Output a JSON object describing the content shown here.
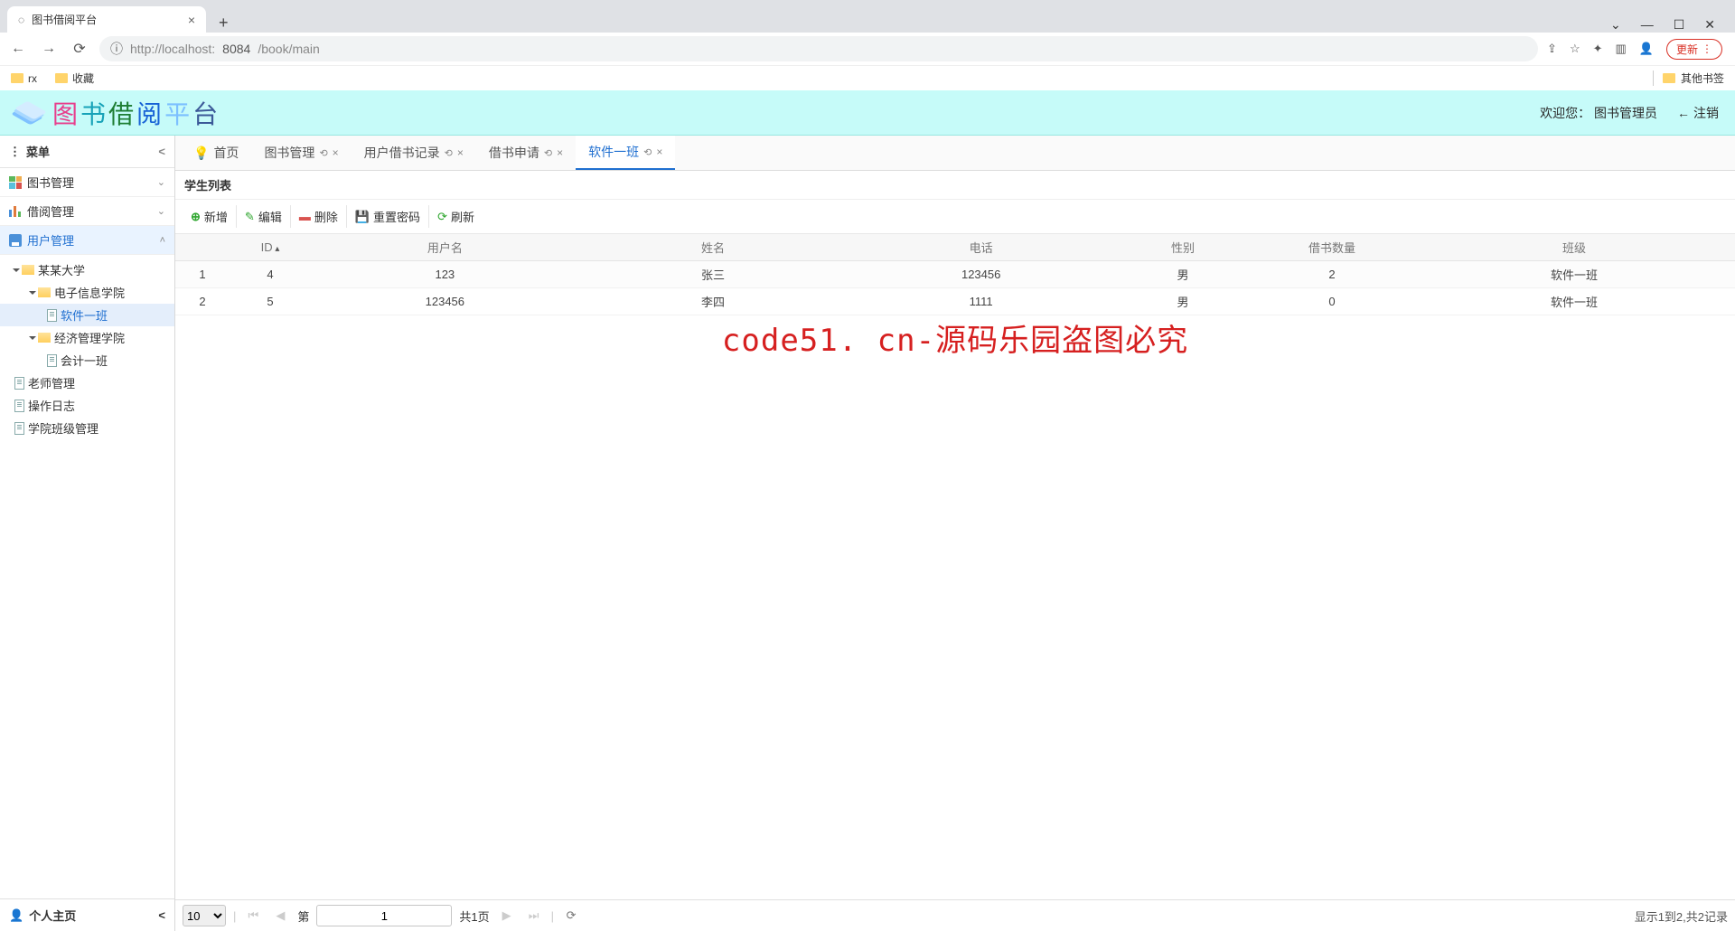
{
  "browser": {
    "tab_title": "图书借阅平台",
    "url_host": "http://localhost:",
    "url_port": "8084",
    "url_path": "/book/main",
    "update_btn": "更新",
    "bookmarks": {
      "rx": "rx",
      "favorites": "收藏",
      "other": "其他书签"
    }
  },
  "header": {
    "title_chars": [
      "图",
      "书",
      "借",
      "阅",
      "平",
      "台"
    ],
    "welcome": "欢迎您：",
    "user_role": "图书管理员",
    "logout": "注销"
  },
  "sidebar": {
    "menu_title": "菜单",
    "nav": {
      "book_mgmt": "图书管理",
      "borrow_mgmt": "借阅管理",
      "user_mgmt": "用户管理"
    },
    "tree": {
      "u": "某某大学",
      "c1": "电子信息学院",
      "c1a": "软件一班",
      "c2": "经济管理学院",
      "c2a": "会计一班",
      "t1": "老师管理",
      "t2": "操作日志",
      "t3": "学院班级管理"
    },
    "footer": "个人主页"
  },
  "tabs": {
    "home": "首页",
    "book": "图书管理",
    "record": "用户借书记录",
    "apply": "借书申请",
    "class": "软件一班"
  },
  "panel": {
    "title": "学生列表"
  },
  "toolbar": {
    "add": "新增",
    "edit": "编辑",
    "delete": "删除",
    "reset": "重置密码",
    "refresh": "刷新"
  },
  "columns": {
    "id": "ID",
    "username": "用户名",
    "name": "姓名",
    "phone": "电话",
    "gender": "性别",
    "borrow_count": "借书数量",
    "class": "班级"
  },
  "rows": [
    {
      "idx": "1",
      "id": "4",
      "username": "123",
      "name": "张三",
      "phone": "123456",
      "gender": "男",
      "borrow_count": "2",
      "class": "软件一班"
    },
    {
      "idx": "2",
      "id": "5",
      "username": "123456",
      "name": "李四",
      "phone": "1111",
      "gender": "男",
      "borrow_count": "0",
      "class": "软件一班"
    }
  ],
  "pager": {
    "page_size": "10",
    "page_label_prefix": "第",
    "page_input": "1",
    "page_total": "共1页",
    "status": "显示1到2,共2记录"
  },
  "watermark": "code51. cn-源码乐园盗图必究"
}
